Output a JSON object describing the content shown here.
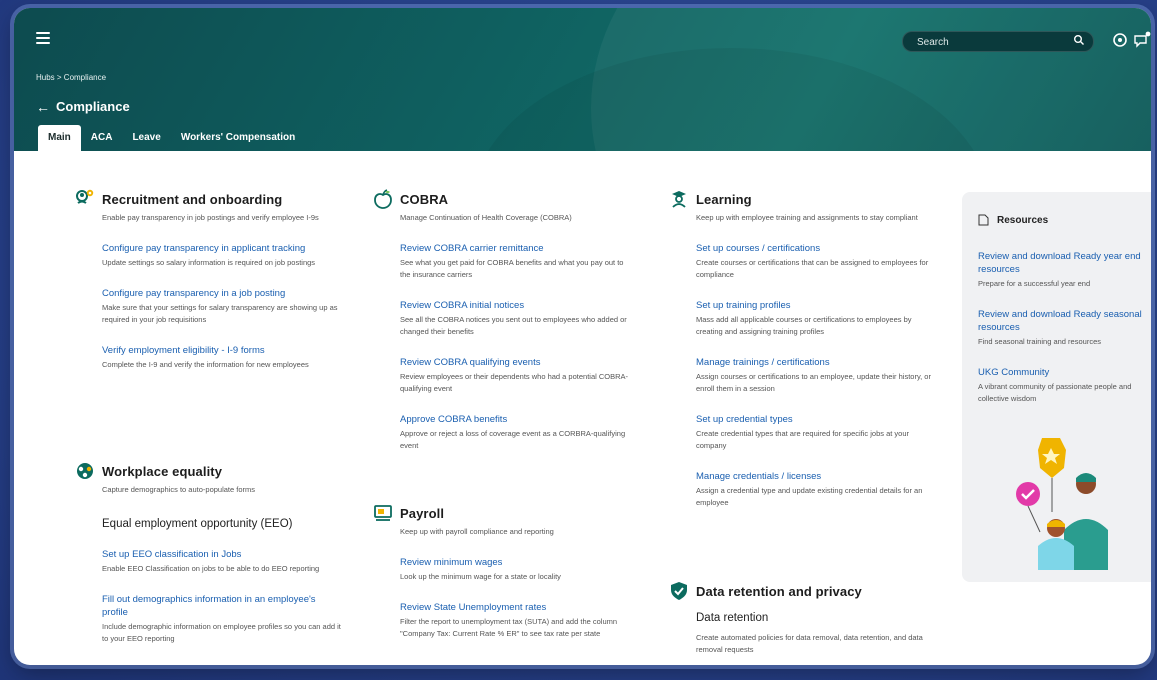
{
  "header": {
    "search": {
      "placeholder": "Search"
    },
    "breadcrumb": "Hubs > Compliance",
    "title": "Compliance",
    "back_arrow": "←",
    "tabs": [
      {
        "label": "Main",
        "active": true
      },
      {
        "label": "ACA",
        "active": false
      },
      {
        "label": "Leave",
        "active": false
      },
      {
        "label": "Workers' Compensation",
        "active": false
      }
    ],
    "icons": [
      "menu-icon",
      "search-icon",
      "help-icon",
      "chat-icon"
    ]
  },
  "columns": {
    "recruitment": {
      "title": "Recruitment and onboarding",
      "icon": "recruitment-icon",
      "desc": "Enable pay transparency in job postings and verify employee I-9s",
      "items": [
        {
          "link": "Configure pay transparency in applicant tracking",
          "desc": "Update settings so salary information is required on job postings"
        },
        {
          "link": "Configure pay transparency in a job posting",
          "desc": "Make sure that your settings for salary transparency are showing up as required in your job requisitions"
        },
        {
          "link": "Verify employment eligibility - I-9 forms",
          "desc": "Complete the I-9 and verify the information for new employees"
        }
      ]
    },
    "workplace": {
      "title": "Workplace equality",
      "icon": "equality-icon",
      "desc": "Capture demographics to auto-populate forms",
      "subhead": "Equal employment opportunity (EEO)",
      "items": [
        {
          "link": "Set up EEO classification in Jobs",
          "desc": "Enable EEO Classification on jobs to be able to do EEO reporting"
        },
        {
          "link": "Fill out demographics information in an employee's profile",
          "desc": "Include demographic information on employee profiles so you can add it to your EEO reporting"
        }
      ]
    },
    "cobra": {
      "title": "COBRA",
      "icon": "apple-icon",
      "desc": "Manage Continuation of Health Coverage (COBRA)",
      "items": [
        {
          "link": "Review COBRA carrier remittance",
          "desc": "See what you get paid for COBRA benefits and what you pay out to the insurance carriers"
        },
        {
          "link": "Review COBRA initial notices",
          "desc": "See all the COBRA notices you sent out to employees who added or changed their benefits"
        },
        {
          "link": "Review COBRA qualifying events",
          "desc": "Review employees or their dependents who had a potential COBRA-qualifying event"
        },
        {
          "link": "Approve COBRA benefits",
          "desc": "Approve or reject a loss of coverage event as a CORBRA-qualifying event"
        }
      ]
    },
    "payroll": {
      "title": "Payroll",
      "icon": "payroll-icon",
      "desc": "Keep up with payroll compliance and reporting",
      "items": [
        {
          "link": "Review minimum wages",
          "desc": "Look up the minimum wage for a state or locality"
        },
        {
          "link": "Review State Unemployment rates",
          "desc": "Filter the report to unemployment tax (SUTA) and add the column \"Company Tax: Current Rate % ER\" to see tax rate per state"
        }
      ]
    },
    "learning": {
      "title": "Learning",
      "icon": "learning-icon",
      "desc": "Keep up with employee training and assignments to stay compliant",
      "items": [
        {
          "link": "Set up courses / certifications",
          "desc": "Create courses or certifications that can be assigned to employees for compliance"
        },
        {
          "link": "Set up training profiles",
          "desc": "Mass add all applicable courses or certifications to employees by creating and assigning training profiles"
        },
        {
          "link": "Manage trainings / certifications",
          "desc": "Assign courses or certifications to an employee, update their history, or enroll them in a session"
        },
        {
          "link": "Set up credential types",
          "desc": "Create credential types that are required for specific jobs at your company"
        },
        {
          "link": "Manage credentials / licenses",
          "desc": "Assign a credential type and update existing credential details for an employee"
        }
      ]
    },
    "privacy": {
      "title": "Data retention and privacy",
      "icon": "shield-check-icon",
      "subhead": "Data retention",
      "desc": "Create automated policies for data removal, data retention, and data removal requests"
    }
  },
  "resources": {
    "title": "Resources",
    "icon": "document-icon",
    "items": [
      {
        "link": "Review and download Ready year end resources",
        "desc": "Prepare for a successful year end"
      },
      {
        "link": "Review and download Ready seasonal resources",
        "desc": "Find seasonal training and resources"
      },
      {
        "link": "UKG Community",
        "desc": "A vibrant community of passionate people and collective wisdom"
      }
    ]
  },
  "colors": {
    "header": "#0f5f5f",
    "link": "#1a5fb0",
    "page_bg": "#2a4590"
  }
}
